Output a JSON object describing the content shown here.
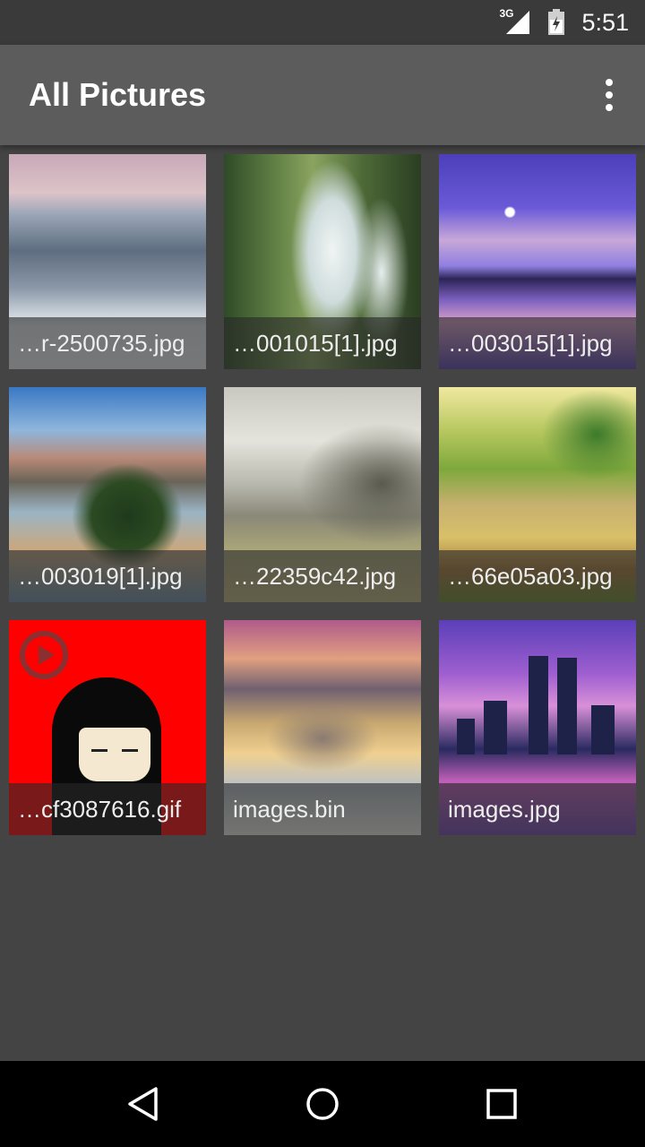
{
  "status_bar": {
    "network": "3G",
    "time": "5:51",
    "icons": [
      "signal-icon",
      "battery-icon"
    ]
  },
  "app_bar": {
    "title": "All Pictures",
    "menu_icon": "overflow-menu-icon"
  },
  "gallery": {
    "items": [
      {
        "caption": "…r-2500735.jpg"
      },
      {
        "caption": "…001015[1].jpg"
      },
      {
        "caption": "…003015[1].jpg"
      },
      {
        "caption": "…003019[1].jpg"
      },
      {
        "caption": "…22359c42.jpg"
      },
      {
        "caption": "…66e05a03.jpg"
      },
      {
        "caption": "…cf3087616.gif"
      },
      {
        "caption": "images.bin"
      },
      {
        "caption": "images.jpg"
      }
    ]
  },
  "nav_bar": {
    "icons": [
      "back-icon",
      "home-icon",
      "recents-icon"
    ]
  }
}
